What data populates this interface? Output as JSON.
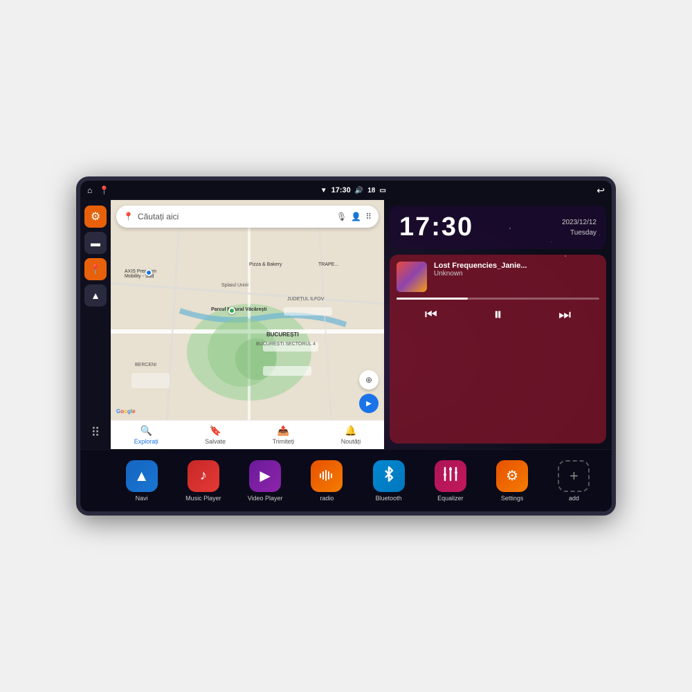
{
  "device": {
    "status_bar": {
      "wifi_icon": "▼",
      "time": "17:30",
      "volume_icon": "🔊",
      "battery_level": "18",
      "battery_icon": "🔋",
      "back_icon": "↩"
    }
  },
  "map": {
    "search_placeholder": "Căutați aici",
    "location_label1": "AXIS Premium Mobility - Sud",
    "location_label2": "Pizza & Bakery",
    "location_label3": "Parcul Natural Văcărești",
    "area_label1": "BUCUREȘTI",
    "area_label2": "BUCUREȘTI SECTORUL 4",
    "area_label3": "BERCENI",
    "area_label4": "JUDEȚUL ILFOV",
    "nav_items": [
      {
        "label": "Explorați",
        "icon": "🔍",
        "active": true
      },
      {
        "label": "Salvate",
        "icon": "🔖",
        "active": false
      },
      {
        "label": "Trimiteți",
        "icon": "📤",
        "active": false
      },
      {
        "label": "Noutăți",
        "icon": "🔔",
        "active": false
      }
    ]
  },
  "clock": {
    "time": "17:30",
    "date": "2023/12/12",
    "day": "Tuesday"
  },
  "music": {
    "title": "Lost Frequencies_Janie...",
    "artist": "Unknown",
    "progress": 35,
    "controls": {
      "prev": "⏮",
      "pause": "⏸",
      "next": "⏭"
    }
  },
  "sidebar": {
    "items": [
      {
        "label": "settings",
        "icon": "⚙",
        "color": "orange"
      },
      {
        "label": "files",
        "icon": "📁",
        "color": "dark"
      },
      {
        "label": "maps",
        "icon": "📍",
        "color": "orange"
      },
      {
        "label": "navigation",
        "icon": "▲",
        "color": "dark"
      }
    ],
    "apps_icon": "⠿"
  },
  "apps": [
    {
      "id": "navi",
      "label": "Navi",
      "icon": "▲",
      "color_class": "app-navi"
    },
    {
      "id": "music",
      "label": "Music Player",
      "icon": "♪",
      "color_class": "app-music"
    },
    {
      "id": "video",
      "label": "Video Player",
      "icon": "▶",
      "color_class": "app-video"
    },
    {
      "id": "radio",
      "label": "radio",
      "icon": "📻",
      "color_class": "app-radio"
    },
    {
      "id": "bluetooth",
      "label": "Bluetooth",
      "icon": "⬡",
      "color_class": "app-bt"
    },
    {
      "id": "equalizer",
      "label": "Equalizer",
      "icon": "≡",
      "color_class": "app-eq"
    },
    {
      "id": "settings",
      "label": "Settings",
      "icon": "⚙",
      "color_class": "app-settings"
    },
    {
      "id": "add",
      "label": "add",
      "icon": "+",
      "color_class": "app-add"
    }
  ]
}
